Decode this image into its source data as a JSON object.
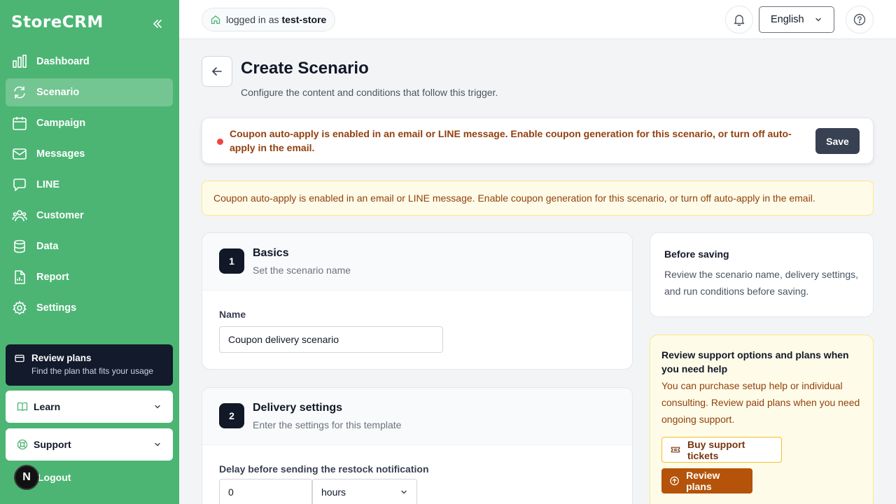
{
  "sidebar": {
    "brand": "StoreCRM",
    "items": [
      {
        "label": "Dashboard",
        "icon": "bar-chart-icon"
      },
      {
        "label": "Scenario",
        "icon": "refresh-icon",
        "active": true
      },
      {
        "label": "Campaign",
        "icon": "calendar-icon"
      },
      {
        "label": "Messages",
        "icon": "mail-icon"
      },
      {
        "label": "LINE",
        "icon": "chat-icon"
      },
      {
        "label": "Customer",
        "icon": "users-icon"
      },
      {
        "label": "Data",
        "icon": "database-icon"
      },
      {
        "label": "Report",
        "icon": "report-icon"
      },
      {
        "label": "Settings",
        "icon": "gear-icon"
      }
    ],
    "plans_card": {
      "title": "Review plans",
      "subtitle": "Find the plan that fits your usage"
    },
    "learn_label": "Learn",
    "support_label": "Support",
    "logout_label": "Logout",
    "avatar_letter": "N"
  },
  "topbar": {
    "login_prefix": "logged in as",
    "username": "test-store",
    "language": "English"
  },
  "header": {
    "title": "Create Scenario",
    "subtitle": "Configure the content and conditions that follow this trigger."
  },
  "alert": {
    "message": "Coupon auto-apply is enabled in an email or LINE message. Enable coupon generation for this scenario, or turn off auto-apply in the email.",
    "save_label": "Save"
  },
  "warning": {
    "message": "Coupon auto-apply is enabled in an email or LINE message. Enable coupon generation for this scenario, or turn off auto-apply in the email."
  },
  "basics": {
    "step": "1",
    "title": "Basics",
    "subtitle": "Set the scenario name",
    "name_label": "Name",
    "name_value": "Coupon delivery scenario"
  },
  "delivery": {
    "step": "2",
    "title": "Delivery settings",
    "subtitle": "Enter the settings for this template",
    "delay_label": "Delay before sending the restock notification",
    "delay_value": "0",
    "delay_unit": "hours"
  },
  "before_saving": {
    "title": "Before saving",
    "description": "Review the scenario name, delivery settings, and run conditions before saving."
  },
  "support": {
    "title": "Review support options and plans when you need help",
    "description": "You can purchase setup help or individual consulting. Review paid plans when you need ongoing support.",
    "tickets_label": "Buy support tickets",
    "review_label": "Review plans"
  },
  "colors": {
    "sidebar_green": "#4cb574",
    "dark": "#111827",
    "warning_text": "#92400e",
    "review_button": "#b45309"
  }
}
